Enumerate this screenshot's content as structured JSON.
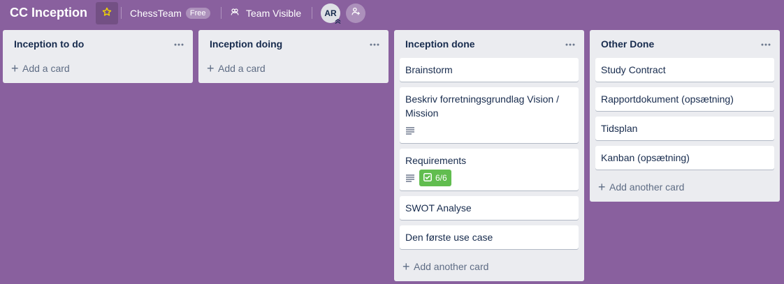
{
  "header": {
    "board_title": "CC Inception",
    "star_icon": "star-outline-icon",
    "team_name": "ChessTeam",
    "plan_badge": "Free",
    "visibility_label": "Team Visible",
    "avatar_initials": "AR",
    "colors": {
      "background": "#89609e",
      "star": "#f2d600"
    }
  },
  "lists": [
    {
      "title": "Inception to do",
      "cards": [],
      "add_label": "Add a card"
    },
    {
      "title": "Inception doing",
      "cards": [],
      "add_label": "Add a card"
    },
    {
      "title": "Inception done",
      "cards": [
        {
          "title": "Brainstorm"
        },
        {
          "title": "Beskriv forretningsgrundlag Vision / Mission",
          "has_description": true
        },
        {
          "title": "Requirements",
          "has_description": true,
          "checklist": "6/6"
        },
        {
          "title": "SWOT Analyse"
        },
        {
          "title": "Den første use case"
        }
      ],
      "add_label": "Add another card"
    },
    {
      "title": "Other Done",
      "cards": [
        {
          "title": "Study Contract"
        },
        {
          "title": "Rapportdokument (opsætning)"
        },
        {
          "title": "Tidsplan"
        },
        {
          "title": "Kanban (opsætning)"
        }
      ],
      "add_label": "Add another card"
    }
  ],
  "badge_colors": {
    "checklist_complete": "#61bd4f"
  }
}
